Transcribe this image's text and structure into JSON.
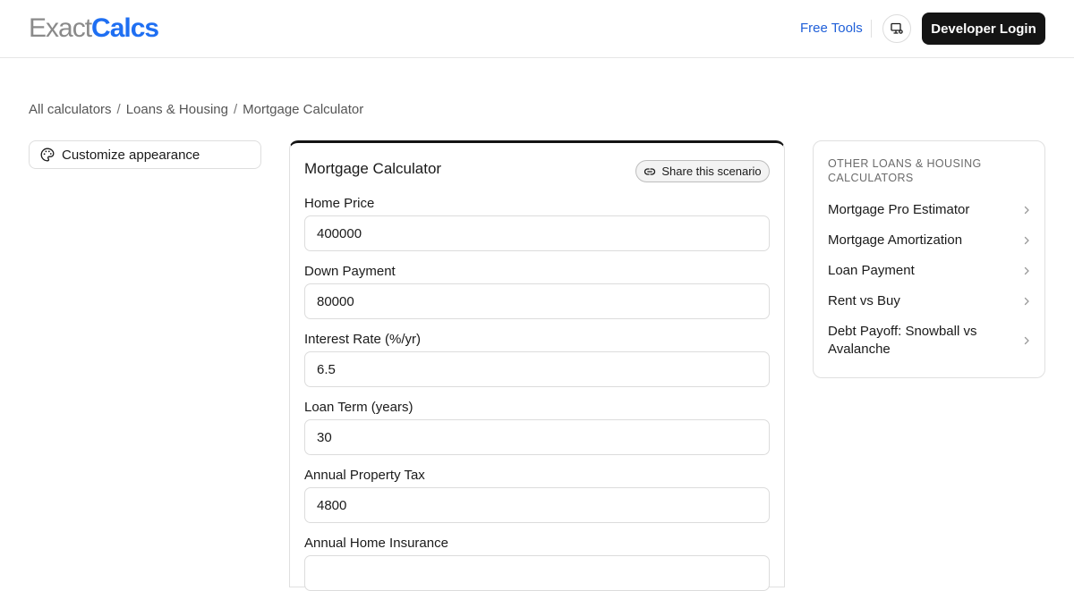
{
  "header": {
    "logo_light": "Exact",
    "logo_bold": "Calcs",
    "free_tools": "Free Tools",
    "developer_login": "Developer Login",
    "icon": "monitor-settings-icon"
  },
  "breadcrumb": {
    "items": [
      "All calculators",
      "Loans & Housing",
      "Mortgage Calculator"
    ],
    "separator": "/"
  },
  "customize": {
    "label": "Customize appearance",
    "icon": "palette-icon"
  },
  "calculator": {
    "title": "Mortgage Calculator",
    "share_label": "Share this scenario",
    "share_icon": "link-icon",
    "fields": [
      {
        "label": "Home Price",
        "value": "400000"
      },
      {
        "label": "Down Payment",
        "value": "80000"
      },
      {
        "label": "Interest Rate (%/yr)",
        "value": "6.5"
      },
      {
        "label": "Loan Term (years)",
        "value": "30"
      },
      {
        "label": "Annual Property Tax",
        "value": "4800"
      },
      {
        "label": "Annual Home Insurance",
        "value": ""
      }
    ]
  },
  "sidebar": {
    "heading": "OTHER LOANS & HOUSING CALCULATORS",
    "items": [
      {
        "label": "Mortgage Pro Estimator"
      },
      {
        "label": "Mortgage Amortization"
      },
      {
        "label": "Loan Payment"
      },
      {
        "label": "Rent vs Buy"
      },
      {
        "label": "Debt Payoff: Snowball vs Avalanche"
      }
    ]
  },
  "colors": {
    "brand_blue": "#1f6ff2",
    "link_blue": "#1f5fd8",
    "dark_button": "#141414"
  }
}
